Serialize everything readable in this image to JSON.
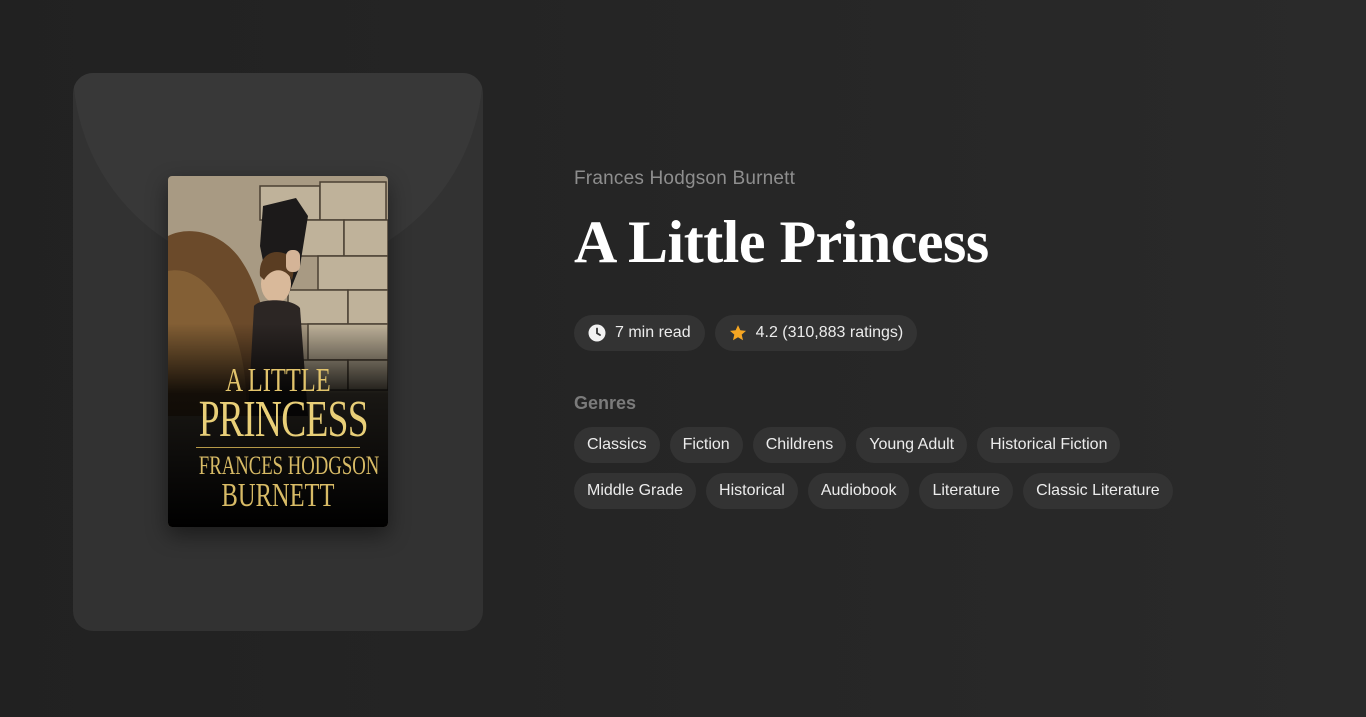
{
  "book": {
    "author": "Frances Hodgson Burnett",
    "title": "A Little Princess",
    "cover": {
      "title_line1": "A LITTLE",
      "title_line2": "PRINCESS",
      "author_line1": "FRANCES HODGSON",
      "author_line2": "BURNETT"
    }
  },
  "meta": {
    "read_time": "7 min read",
    "read_time_icon": "clock-icon",
    "rating": "4.2 (310,883 ratings)",
    "rating_icon": "star-icon",
    "rating_color": "#f5a623"
  },
  "genres": {
    "label": "Genres",
    "items": [
      "Classics",
      "Fiction",
      "Childrens",
      "Young Adult",
      "Historical Fiction",
      "Middle Grade",
      "Historical",
      "Audiobook",
      "Literature",
      "Classic Literature"
    ]
  }
}
